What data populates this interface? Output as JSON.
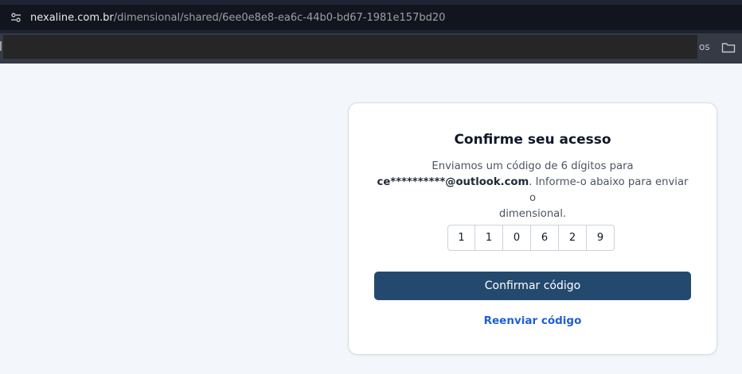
{
  "browser": {
    "url_domain": "nexaline.com.br",
    "url_path": "/dimensional/shared/6ee0e8e8-ea6c-44b0-bd67-1981e157bd20",
    "bookmark_trailing_text": "os",
    "site_info_icon": "tune-icon",
    "bookmarks_folder_icon": "folder-icon"
  },
  "card": {
    "title": "Confirme seu acesso",
    "desc_line1": "Enviamos um código de 6 dígitos para",
    "email": "ce**********@outlook.com",
    "desc_line2_rest": ". Informe-o abaixo para enviar o",
    "desc_line3": "dimensional.",
    "code": [
      "1",
      "1",
      "0",
      "6",
      "2",
      "9"
    ],
    "confirm_label": "Confirmar código",
    "resend_label": "Reenviar código"
  },
  "colors": {
    "primary_button": "#234a6e",
    "link": "#1d5fd6",
    "page_background": "#f3f6fb"
  }
}
